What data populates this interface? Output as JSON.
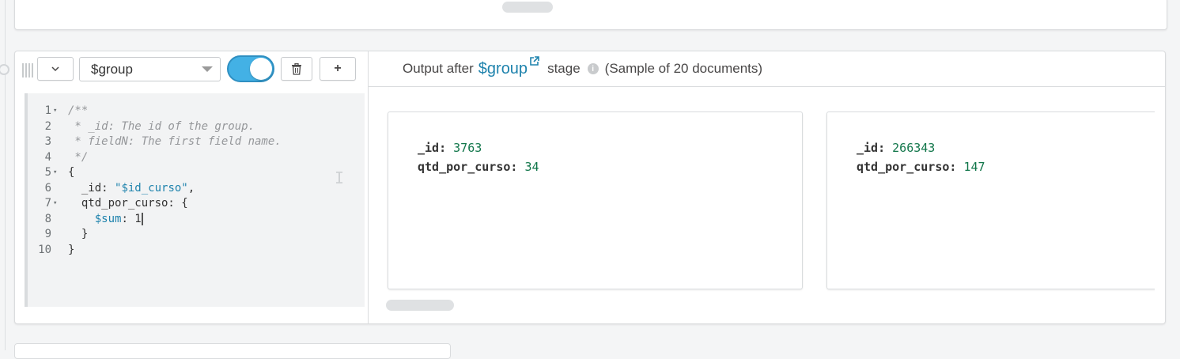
{
  "stage": {
    "operator": "$group",
    "collapse_icon": "chevron-down-icon",
    "delete_icon": "trash-icon",
    "add_label": "+",
    "enabled": true
  },
  "editor": {
    "lines": [
      {
        "n": "1",
        "fold": "▾",
        "parts": [
          {
            "t": "/**",
            "c": "cm"
          }
        ]
      },
      {
        "n": "2",
        "fold": "",
        "parts": [
          {
            "t": " * _id: The id of the group.",
            "c": "cm"
          }
        ]
      },
      {
        "n": "3",
        "fold": "",
        "parts": [
          {
            "t": " * fieldN: The first field name.",
            "c": "cm"
          }
        ]
      },
      {
        "n": "4",
        "fold": "",
        "parts": [
          {
            "t": " */",
            "c": "cm"
          }
        ]
      },
      {
        "n": "5",
        "fold": "▾",
        "parts": [
          {
            "t": "{",
            "c": ""
          }
        ]
      },
      {
        "n": "6",
        "fold": "",
        "parts": [
          {
            "t": "  _id: ",
            "c": ""
          },
          {
            "t": "\"$id_curso\"",
            "c": "str"
          },
          {
            "t": ",",
            "c": ""
          }
        ]
      },
      {
        "n": "7",
        "fold": "▾",
        "parts": [
          {
            "t": "  qtd_por_curso: {",
            "c": ""
          }
        ]
      },
      {
        "n": "8",
        "fold": "",
        "parts": [
          {
            "t": "    ",
            "c": ""
          },
          {
            "t": "$sum",
            "c": "key-d"
          },
          {
            "t": ": ",
            "c": ""
          },
          {
            "t": "1",
            "c": "num"
          }
        ]
      },
      {
        "n": "9",
        "fold": "",
        "parts": [
          {
            "t": "  }",
            "c": ""
          }
        ]
      },
      {
        "n": "10",
        "fold": "",
        "parts": [
          {
            "t": "}",
            "c": ""
          }
        ]
      }
    ]
  },
  "output": {
    "prefix": "Output after",
    "stage_link": "$group",
    "stage_word": "stage",
    "sample_text": "(Sample of 20 documents)",
    "documents": [
      {
        "fields": [
          {
            "key": "_id",
            "value": "3763"
          },
          {
            "key": "qtd_por_curso",
            "value": "34"
          }
        ]
      },
      {
        "fields": [
          {
            "key": "_id",
            "value": "266343"
          },
          {
            "key": "qtd_por_curso",
            "value": "147"
          }
        ]
      }
    ]
  },
  "colors": {
    "accent": "#1f83ad",
    "toggle_on": "#43b1e5",
    "value_green": "#11764a"
  }
}
